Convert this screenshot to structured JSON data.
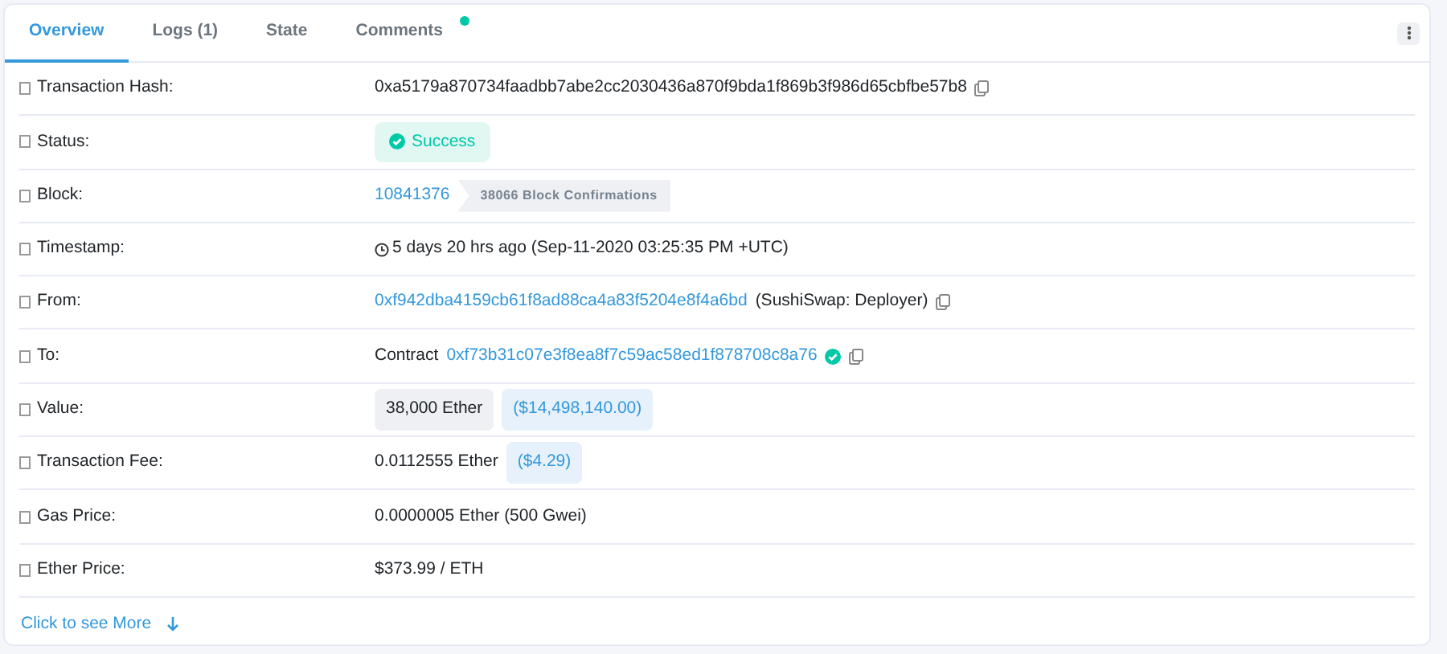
{
  "tabs": [
    {
      "label": "Overview",
      "selected": true,
      "dot": false
    },
    {
      "label": "Logs (1)",
      "selected": false,
      "dot": false
    },
    {
      "label": "State",
      "selected": false,
      "dot": false
    },
    {
      "label": "Comments",
      "selected": false,
      "dot": true
    }
  ],
  "rows": [
    {
      "label": "Transaction Hash:",
      "parts": [
        {
          "kind": "text",
          "text": "0xa5179a870734faadbb7abe2cc2030436a870f9bda1f869b3f986d65cbfbe57b8"
        },
        {
          "kind": "copy"
        }
      ]
    },
    {
      "label": "Status:",
      "parts": [
        {
          "kind": "status",
          "text": "Success"
        }
      ]
    },
    {
      "label": "Block:",
      "parts": [
        {
          "kind": "link",
          "text": "10841376"
        },
        {
          "kind": "confirmations",
          "text": "38066 Block Confirmations"
        }
      ]
    },
    {
      "label": "Timestamp:",
      "parts": [
        {
          "kind": "clock"
        },
        {
          "kind": "text",
          "text": "5 days 20 hrs ago (Sep-11-2020 03:25:35 PM +UTC)"
        }
      ]
    },
    {
      "label": "From:",
      "parts": [
        {
          "kind": "link",
          "text": "0xf942dba4159cb61f8ad88ca4a83f5204e8f4a6bd"
        },
        {
          "kind": "text",
          "text": "(SushiSwap: Deployer)"
        },
        {
          "kind": "copy"
        }
      ]
    },
    {
      "label": "To:",
      "parts": [
        {
          "kind": "text",
          "text": "Contract"
        },
        {
          "kind": "link",
          "text": "0xf73b31c07e3f8ea8f7c59ac58ed1f878708c8a76"
        },
        {
          "kind": "verified"
        },
        {
          "kind": "copy"
        }
      ]
    },
    {
      "label": "Value:",
      "parts": [
        {
          "kind": "pill",
          "text": "38,000 Ether"
        },
        {
          "kind": "usd",
          "text": "($14,498,140.00)"
        }
      ]
    },
    {
      "label": "Transaction Fee:",
      "parts": [
        {
          "kind": "text",
          "text": "0.0112555 Ether"
        },
        {
          "kind": "usd",
          "text": "($4.29)"
        }
      ]
    },
    {
      "label": "Gas Price:",
      "parts": [
        {
          "kind": "text",
          "text": "0.0000005 Ether (500 Gwei)"
        }
      ]
    },
    {
      "label": "Ether Price:",
      "parts": [
        {
          "kind": "text",
          "text": "$373.99 / ETH"
        }
      ]
    }
  ],
  "more_link": "Click to see More"
}
